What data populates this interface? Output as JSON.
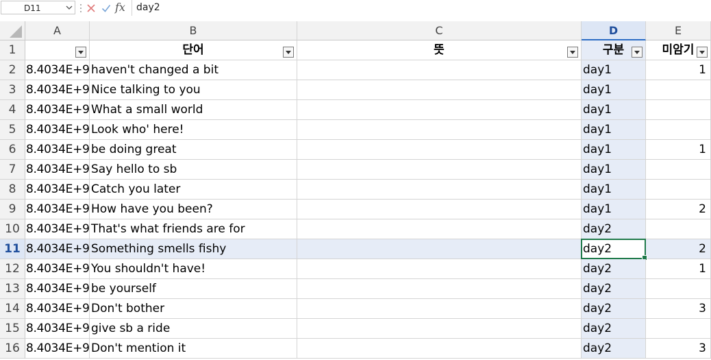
{
  "formula_bar": {
    "name_box": "D11",
    "content": "day2",
    "fx_label": "fx"
  },
  "columns": [
    "A",
    "B",
    "C",
    "D",
    "E"
  ],
  "selected_column": "D",
  "selected_row": "11",
  "header_row": {
    "row_number": "1",
    "cells": [
      "",
      "단어",
      "뜻",
      "구분",
      "미암기"
    ]
  },
  "rows": [
    {
      "n": "2",
      "a": "8.4034E+9",
      "b": "haven't changed a bit",
      "c": "",
      "d": "day1",
      "e": "1"
    },
    {
      "n": "3",
      "a": "8.4034E+9",
      "b": "Nice talking to you",
      "c": "",
      "d": "day1",
      "e": ""
    },
    {
      "n": "4",
      "a": "8.4034E+9",
      "b": "What a small world",
      "c": "",
      "d": "day1",
      "e": ""
    },
    {
      "n": "5",
      "a": "8.4034E+9",
      "b": "Look who' here!",
      "c": "",
      "d": "day1",
      "e": ""
    },
    {
      "n": "6",
      "a": "8.4034E+9",
      "b": "be doing great",
      "c": "",
      "d": "day1",
      "e": "1"
    },
    {
      "n": "7",
      "a": "8.4034E+9",
      "b": "Say hello to sb",
      "c": "",
      "d": "day1",
      "e": ""
    },
    {
      "n": "8",
      "a": "8.4034E+9",
      "b": "Catch you later",
      "c": "",
      "d": "day1",
      "e": ""
    },
    {
      "n": "9",
      "a": "8.4034E+9",
      "b": "How have you been?",
      "c": "",
      "d": "day1",
      "e": "2"
    },
    {
      "n": "10",
      "a": "8.4034E+9",
      "b": "That's what friends are for",
      "c": "",
      "d": "day2",
      "e": ""
    },
    {
      "n": "11",
      "a": "8.4034E+9",
      "b": "Something smells fishy",
      "c": "",
      "d": "day2",
      "e": "2"
    },
    {
      "n": "12",
      "a": "8.4034E+9",
      "b": "You shouldn't have!",
      "c": "",
      "d": "day2",
      "e": "1"
    },
    {
      "n": "13",
      "a": "8.4034E+9",
      "b": "be yourself",
      "c": "",
      "d": "day2",
      "e": ""
    },
    {
      "n": "14",
      "a": "8.4034E+9",
      "b": "Don't bother",
      "c": "",
      "d": "day2",
      "e": "3"
    },
    {
      "n": "15",
      "a": "8.4034E+9",
      "b": "give sb a ride",
      "c": "",
      "d": "day2",
      "e": ""
    },
    {
      "n": "16",
      "a": "8.4034E+9",
      "b": "Don't mention it",
      "c": "",
      "d": "day2",
      "e": "3"
    }
  ],
  "icons": {
    "cancel": "cancel-x-icon",
    "confirm": "confirm-check-icon",
    "function": "function-fx-icon",
    "filter": "filter-dropdown-icon"
  },
  "colors": {
    "selection_fill": "#e6ecf7",
    "selection_header": "#dde6f5",
    "active_border": "#1f7a4a",
    "grid_line": "#d4d4d4"
  }
}
